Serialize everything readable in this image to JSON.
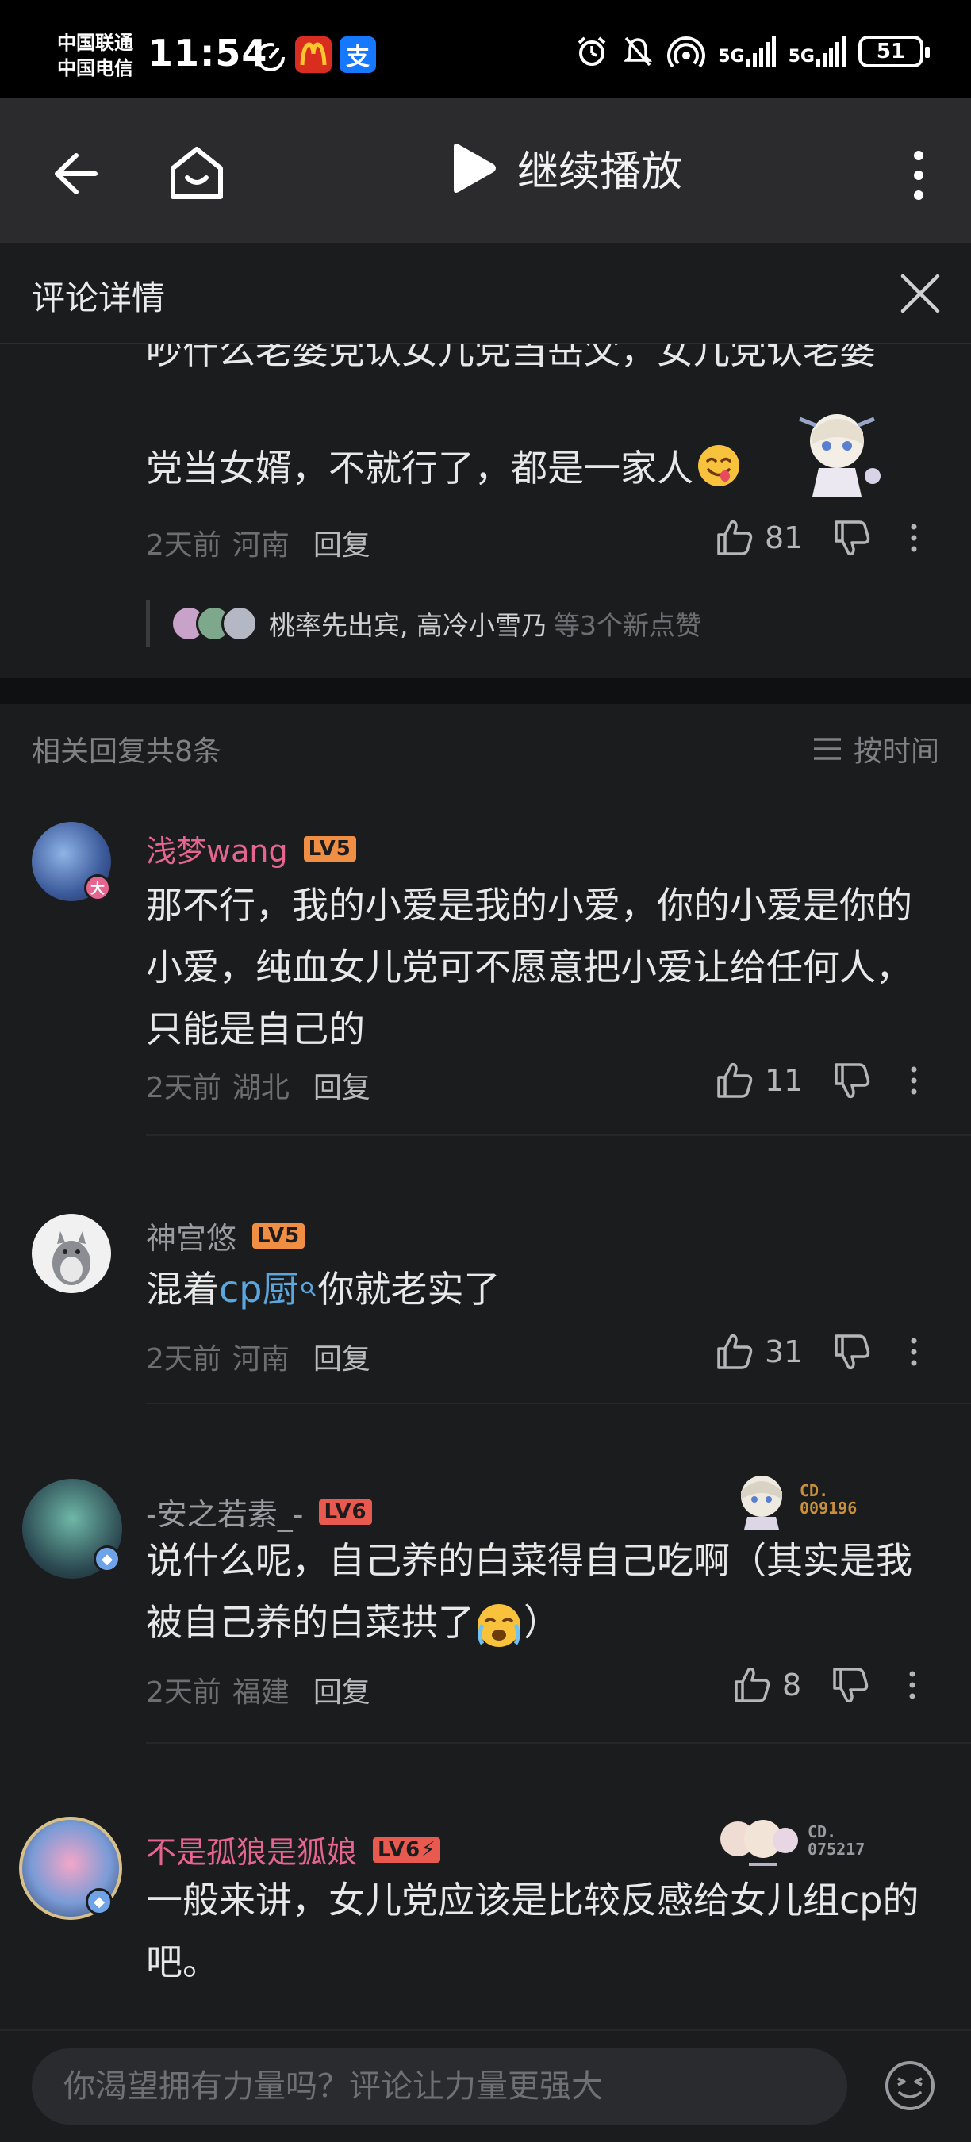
{
  "status_bar": {
    "carrier1": "中国联通",
    "carrier2": "中国电信",
    "time": "11:54",
    "battery": "51",
    "net1": "5G",
    "net2": "5G"
  },
  "topbar": {
    "play_label": "继续播放"
  },
  "detail": {
    "title": "评论详情"
  },
  "main_comment": {
    "line1": "吵什么老婆党认女儿党当岳父，女儿党认老婆",
    "line2": "党当女婿，不就行了，都是一家人",
    "time": "2天前",
    "location": "河南",
    "reply_label": "回复",
    "likes": "81",
    "likers_names": "桃率先出宾, 高冷小雪乃",
    "likers_suffix": "等3个新点赞"
  },
  "replies": {
    "header": "相关回复共8条",
    "sort_label": "按时间",
    "items": [
      {
        "name": "浅梦wang",
        "level": "LV5",
        "text": "那不行，我的小爱是我的小爱，你的小爱是你的小爱，纯血女儿党可不愿意把小爱让给任何人，只能是自己的",
        "time": "2天前",
        "location": "湖北",
        "reply_label": "回复",
        "likes": "11",
        "badge": "大"
      },
      {
        "name": "神宫悠",
        "level": "LV5",
        "text_before": "混着",
        "text_link": "cp厨",
        "text_after": "你就老实了",
        "time": "2天前",
        "location": "河南",
        "reply_label": "回复",
        "likes": "31"
      },
      {
        "name": "-安之若素_-",
        "level": "LV6",
        "fan_no_1": "CD.",
        "fan_no_2": "009196",
        "text": "说什么呢，自己养的白菜得自己吃啊（其实是我被自己养的白菜拱了",
        "text_end": "）",
        "time": "2天前",
        "location": "福建",
        "reply_label": "回复",
        "likes": "8"
      },
      {
        "name": "不是孤狼是狐娘",
        "level": "LV6⚡",
        "fan_no_1": "CD.",
        "fan_no_2": "075217",
        "text": "一般来讲，女儿党应该是比较反感给女儿组cp的吧。"
      }
    ]
  },
  "input": {
    "placeholder": "你渴望拥有力量吗？评论让力量更强大"
  },
  "colors": {
    "background": "#1b1c1e",
    "username_vip": "#e5658e",
    "username_normal": "#9a9ba0",
    "level_orange": "#f08e44",
    "level_red": "#e85a4f",
    "link": "#5aa6dd"
  }
}
